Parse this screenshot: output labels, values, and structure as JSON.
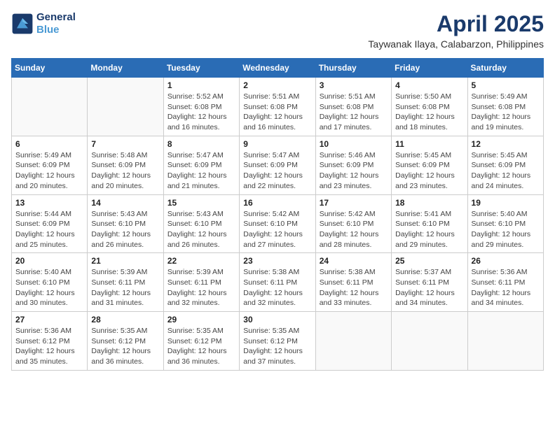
{
  "header": {
    "logo_line1": "General",
    "logo_line2": "Blue",
    "month": "April 2025",
    "location": "Taywanak Ilaya, Calabarzon, Philippines"
  },
  "days_of_week": [
    "Sunday",
    "Monday",
    "Tuesday",
    "Wednesday",
    "Thursday",
    "Friday",
    "Saturday"
  ],
  "weeks": [
    [
      {
        "day": "",
        "info": ""
      },
      {
        "day": "",
        "info": ""
      },
      {
        "day": "1",
        "info": "Sunrise: 5:52 AM\nSunset: 6:08 PM\nDaylight: 12 hours and 16 minutes."
      },
      {
        "day": "2",
        "info": "Sunrise: 5:51 AM\nSunset: 6:08 PM\nDaylight: 12 hours and 16 minutes."
      },
      {
        "day": "3",
        "info": "Sunrise: 5:51 AM\nSunset: 6:08 PM\nDaylight: 12 hours and 17 minutes."
      },
      {
        "day": "4",
        "info": "Sunrise: 5:50 AM\nSunset: 6:08 PM\nDaylight: 12 hours and 18 minutes."
      },
      {
        "day": "5",
        "info": "Sunrise: 5:49 AM\nSunset: 6:08 PM\nDaylight: 12 hours and 19 minutes."
      }
    ],
    [
      {
        "day": "6",
        "info": "Sunrise: 5:49 AM\nSunset: 6:09 PM\nDaylight: 12 hours and 20 minutes."
      },
      {
        "day": "7",
        "info": "Sunrise: 5:48 AM\nSunset: 6:09 PM\nDaylight: 12 hours and 20 minutes."
      },
      {
        "day": "8",
        "info": "Sunrise: 5:47 AM\nSunset: 6:09 PM\nDaylight: 12 hours and 21 minutes."
      },
      {
        "day": "9",
        "info": "Sunrise: 5:47 AM\nSunset: 6:09 PM\nDaylight: 12 hours and 22 minutes."
      },
      {
        "day": "10",
        "info": "Sunrise: 5:46 AM\nSunset: 6:09 PM\nDaylight: 12 hours and 23 minutes."
      },
      {
        "day": "11",
        "info": "Sunrise: 5:45 AM\nSunset: 6:09 PM\nDaylight: 12 hours and 23 minutes."
      },
      {
        "day": "12",
        "info": "Sunrise: 5:45 AM\nSunset: 6:09 PM\nDaylight: 12 hours and 24 minutes."
      }
    ],
    [
      {
        "day": "13",
        "info": "Sunrise: 5:44 AM\nSunset: 6:09 PM\nDaylight: 12 hours and 25 minutes."
      },
      {
        "day": "14",
        "info": "Sunrise: 5:43 AM\nSunset: 6:10 PM\nDaylight: 12 hours and 26 minutes."
      },
      {
        "day": "15",
        "info": "Sunrise: 5:43 AM\nSunset: 6:10 PM\nDaylight: 12 hours and 26 minutes."
      },
      {
        "day": "16",
        "info": "Sunrise: 5:42 AM\nSunset: 6:10 PM\nDaylight: 12 hours and 27 minutes."
      },
      {
        "day": "17",
        "info": "Sunrise: 5:42 AM\nSunset: 6:10 PM\nDaylight: 12 hours and 28 minutes."
      },
      {
        "day": "18",
        "info": "Sunrise: 5:41 AM\nSunset: 6:10 PM\nDaylight: 12 hours and 29 minutes."
      },
      {
        "day": "19",
        "info": "Sunrise: 5:40 AM\nSunset: 6:10 PM\nDaylight: 12 hours and 29 minutes."
      }
    ],
    [
      {
        "day": "20",
        "info": "Sunrise: 5:40 AM\nSunset: 6:10 PM\nDaylight: 12 hours and 30 minutes."
      },
      {
        "day": "21",
        "info": "Sunrise: 5:39 AM\nSunset: 6:11 PM\nDaylight: 12 hours and 31 minutes."
      },
      {
        "day": "22",
        "info": "Sunrise: 5:39 AM\nSunset: 6:11 PM\nDaylight: 12 hours and 32 minutes."
      },
      {
        "day": "23",
        "info": "Sunrise: 5:38 AM\nSunset: 6:11 PM\nDaylight: 12 hours and 32 minutes."
      },
      {
        "day": "24",
        "info": "Sunrise: 5:38 AM\nSunset: 6:11 PM\nDaylight: 12 hours and 33 minutes."
      },
      {
        "day": "25",
        "info": "Sunrise: 5:37 AM\nSunset: 6:11 PM\nDaylight: 12 hours and 34 minutes."
      },
      {
        "day": "26",
        "info": "Sunrise: 5:36 AM\nSunset: 6:11 PM\nDaylight: 12 hours and 34 minutes."
      }
    ],
    [
      {
        "day": "27",
        "info": "Sunrise: 5:36 AM\nSunset: 6:12 PM\nDaylight: 12 hours and 35 minutes."
      },
      {
        "day": "28",
        "info": "Sunrise: 5:35 AM\nSunset: 6:12 PM\nDaylight: 12 hours and 36 minutes."
      },
      {
        "day": "29",
        "info": "Sunrise: 5:35 AM\nSunset: 6:12 PM\nDaylight: 12 hours and 36 minutes."
      },
      {
        "day": "30",
        "info": "Sunrise: 5:35 AM\nSunset: 6:12 PM\nDaylight: 12 hours and 37 minutes."
      },
      {
        "day": "",
        "info": ""
      },
      {
        "day": "",
        "info": ""
      },
      {
        "day": "",
        "info": ""
      }
    ]
  ]
}
